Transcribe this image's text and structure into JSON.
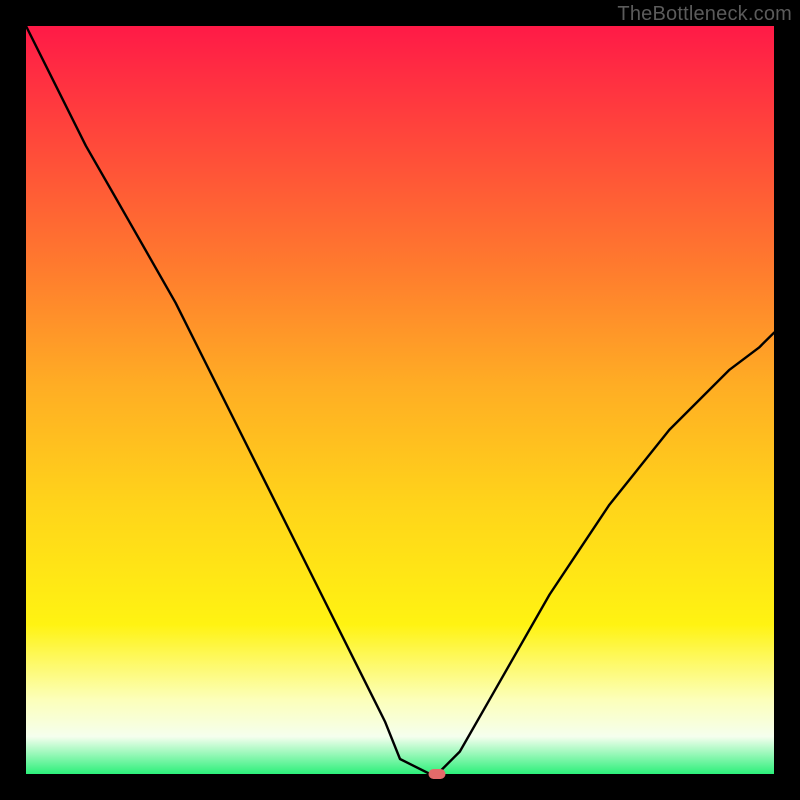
{
  "watermark": "TheBottleneck.com",
  "colors": {
    "frame_bg": "#000000",
    "curve_stroke": "#000000",
    "marker_fill": "#e46a6a",
    "gradient_stops": [
      "#ff1a47",
      "#ff4a3a",
      "#ff7a2e",
      "#ffad24",
      "#ffd41a",
      "#fff312",
      "#fcffb9",
      "#f5ffee",
      "#2cf07a"
    ]
  },
  "chart_data": {
    "type": "line",
    "title": "",
    "xlabel": "",
    "ylabel": "",
    "xlim": [
      0,
      100
    ],
    "ylim": [
      0,
      100
    ],
    "grid": false,
    "x": [
      0,
      4,
      8,
      12,
      16,
      20,
      24,
      28,
      32,
      36,
      40,
      44,
      48,
      50,
      54,
      55,
      58,
      62,
      66,
      70,
      74,
      78,
      82,
      86,
      90,
      94,
      98,
      100
    ],
    "values": [
      100,
      92,
      84,
      77,
      70,
      63,
      55,
      47,
      39,
      31,
      23,
      15,
      7,
      2,
      0,
      0,
      3,
      10,
      17,
      24,
      30,
      36,
      41,
      46,
      50,
      54,
      57,
      59
    ],
    "marker": {
      "x": 55,
      "y": 0
    },
    "note": "Values are percentage heights read off the plot (0 = bottom, 100 = top); x is normalized horizontal position."
  }
}
